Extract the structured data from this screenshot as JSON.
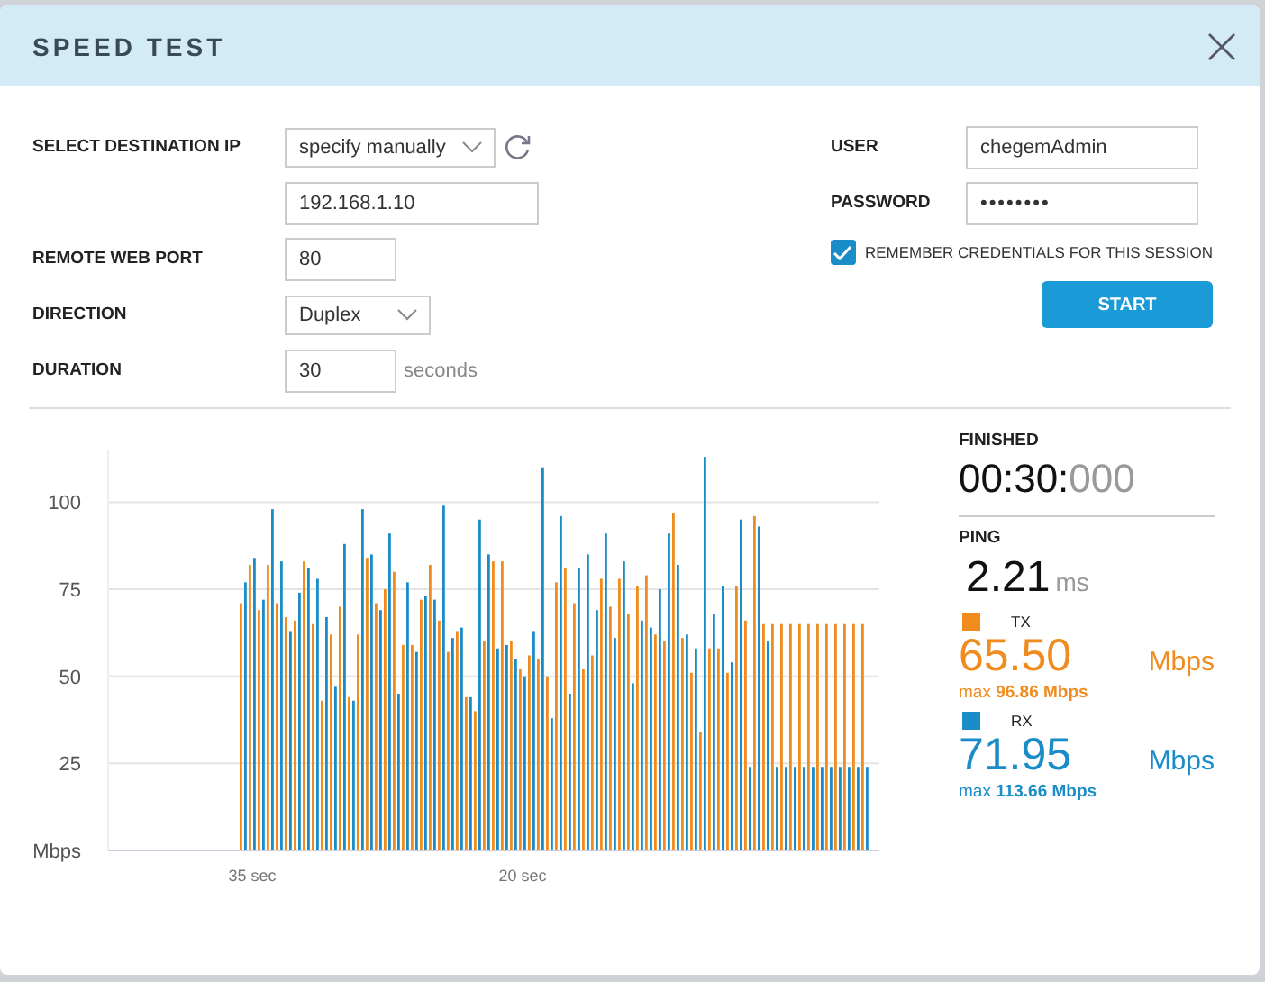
{
  "window": {
    "title": "SPEED TEST"
  },
  "form": {
    "destination": {
      "label": "SELECT DESTINATION IP",
      "value": "specify manually"
    },
    "ip": {
      "value": "192.168.1.10"
    },
    "port": {
      "label": "REMOTE WEB PORT",
      "value": "80"
    },
    "direction": {
      "label": "DIRECTION",
      "value": "Duplex"
    },
    "duration": {
      "label": "DURATION",
      "value": "30",
      "unit": "seconds"
    },
    "user": {
      "label": "USER",
      "value": "chegemAdmin"
    },
    "password": {
      "label": "PASSWORD",
      "value": "••••••••"
    },
    "remember": {
      "label": "REMEMBER CREDENTIALS FOR THIS SESSION",
      "checked": true
    },
    "start": "START"
  },
  "chart_data": {
    "type": "bar",
    "xlim": [
      43,
      0.2
    ],
    "ylim": [
      0,
      115
    ],
    "grid": true,
    "x": [
      35.7,
      35.2,
      34.7,
      34.2,
      33.7,
      33.2,
      32.7,
      32.2,
      31.7,
      31.2,
      30.7,
      30.2,
      29.7,
      29.2,
      28.7,
      28.2,
      27.7,
      27.2,
      26.7,
      26.2,
      25.7,
      25.2,
      24.7,
      24.2,
      23.7,
      23.2,
      22.7,
      22.2,
      21.7,
      21.2,
      20.7,
      20.2,
      19.7,
      19.2,
      18.7,
      18.2,
      17.7,
      17.2,
      16.7,
      16.2,
      15.7,
      15.2,
      14.7,
      14.2,
      13.7,
      13.2,
      12.7,
      12.2,
      11.7,
      11.2,
      10.7,
      10.2,
      9.7,
      9.2,
      8.7,
      8.2,
      7.7,
      7.2,
      6.7,
      6.2,
      5.7,
      5.2,
      4.7,
      4.2,
      3.7,
      3.2,
      2.7,
      2.2,
      1.7,
      1.2
    ],
    "xticks": [
      {
        "value": 35,
        "label": "35 sec"
      },
      {
        "value": 20,
        "label": "20 sec"
      }
    ],
    "yticks": [
      {
        "value": 0,
        "label": "Mbps"
      },
      25,
      50,
      75,
      100
    ],
    "series": [
      {
        "name": "TX",
        "color": "#f08c1e",
        "values": [
          71,
          82,
          69,
          82,
          71,
          67,
          66,
          83,
          65,
          43,
          62,
          70,
          44,
          62,
          84,
          71,
          75,
          80,
          59,
          59,
          72,
          82,
          66,
          57,
          63,
          44,
          40,
          60,
          83,
          83,
          60,
          52,
          56,
          55,
          50,
          77,
          81,
          71,
          52,
          56,
          78,
          70,
          78,
          68,
          76,
          79,
          62,
          60,
          97,
          61,
          51,
          34,
          58,
          58,
          51,
          76,
          66,
          96,
          65,
          65,
          65,
          65,
          65,
          65,
          65,
          65,
          65,
          65,
          65,
          65
        ]
      },
      {
        "name": "RX",
        "color": "#1a8cc8",
        "values": [
          77,
          84,
          72,
          98,
          83,
          63,
          74,
          81,
          78,
          67,
          47,
          88,
          43,
          98,
          85,
          69,
          91,
          45,
          77,
          57,
          73,
          72,
          99,
          61,
          64,
          44,
          95,
          85,
          58,
          59,
          55,
          50,
          63,
          110,
          38,
          96,
          45,
          81,
          85,
          69,
          91,
          61,
          83,
          48,
          66,
          64,
          75,
          91,
          82,
          62,
          58,
          113,
          68,
          76,
          54,
          95,
          24,
          93,
          60,
          24,
          24,
          24,
          24,
          24,
          24,
          24,
          24,
          24,
          24,
          24
        ]
      }
    ]
  },
  "status": {
    "label": "FINISHED",
    "time_main": "00:30:",
    "time_ms": "000"
  },
  "ping": {
    "label": "PING",
    "value": "2.21",
    "unit": "ms"
  },
  "traffic": [
    {
      "value": "65.50",
      "unit": "Mbps",
      "max_prefix": "max",
      "max": "96.86 Mbps"
    },
    {
      "value": "71.95",
      "unit": "Mbps",
      "max_prefix": "max",
      "max": "113.66 Mbps"
    }
  ]
}
